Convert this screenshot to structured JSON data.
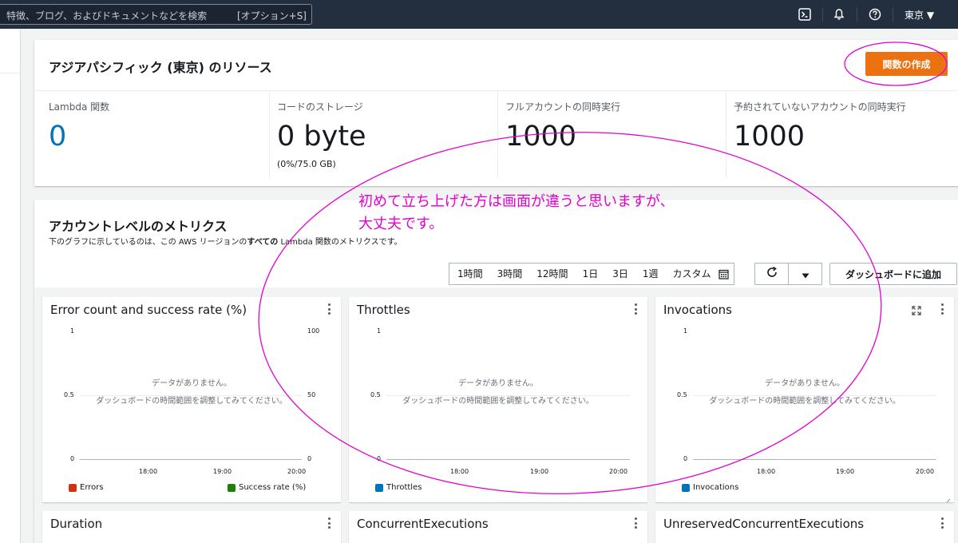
{
  "search": {
    "placeholder": "特徴、ブログ、およびドキュメントなどを検索",
    "shortcut": "[オプション+S]"
  },
  "nav": {
    "region": "東京 ▼"
  },
  "resources": {
    "title": "アジアパシフィック (東京) のリソース",
    "create_button": "関数の作成",
    "stats": [
      {
        "label": "Lambda 関数",
        "value": "0"
      },
      {
        "label": "コードのストレージ",
        "value": "0 byte",
        "sub": "(0%/75.0 GB)"
      },
      {
        "label": "フルアカウントの同時実行",
        "value": "1000"
      },
      {
        "label": "予約されていないアカウントの同時実行",
        "value": "1000"
      }
    ]
  },
  "metrics": {
    "title": "アカウントレベルのメトリクス",
    "desc_pre": "下のグラフに示しているのは、この AWS リージョンの",
    "desc_bold": "すべての",
    "desc_post": " Lambda 関数のメトリクスです。",
    "ranges": [
      "1時間",
      "3時間",
      "12時間",
      "1日",
      "3日",
      "1週",
      "カスタム"
    ],
    "add_dashboard": "ダッシュボードに追加"
  },
  "charts": [
    {
      "title": "Error count and success rate (%)",
      "y_left": [
        "1",
        "0.5",
        "0"
      ],
      "y_right": [
        "100",
        "50",
        "0"
      ],
      "x": [
        "18:00",
        "19:00",
        "20:00"
      ],
      "nodata_1": "データがありません。",
      "nodata_2": "ダッシュボードの時間範囲を調整してみてください。",
      "legend": [
        {
          "name": "Errors",
          "color": "#d13212"
        },
        {
          "name": "Success rate (%)",
          "color": "#1d8102"
        }
      ]
    },
    {
      "title": "Throttles",
      "y_left": [
        "1",
        "0.5",
        "0"
      ],
      "x": [
        "18:00",
        "19:00",
        "20:00"
      ],
      "nodata_1": "データがありません。",
      "nodata_2": "ダッシュボードの時間範囲を調整してみてください。",
      "legend": [
        {
          "name": "Throttles",
          "color": "#0073bb"
        }
      ]
    },
    {
      "title": "Invocations",
      "y_left": [
        "1",
        "0.5",
        "0"
      ],
      "x": [
        "18:00",
        "19:00",
        "20:00"
      ],
      "nodata_1": "データがありません。",
      "nodata_2": "ダッシュボードの時間範囲を調整してみてください。",
      "legend": [
        {
          "name": "Invocations",
          "color": "#0073bb"
        }
      ]
    }
  ],
  "bottom_cards": [
    {
      "title": "Duration"
    },
    {
      "title": "ConcurrentExecutions"
    },
    {
      "title": "UnreservedConcurrentExecutions"
    }
  ],
  "annotation": {
    "line1": "初めて立ち上げた方は画面が違うと思いますが、",
    "line2": "大丈夫です。",
    "color": "#e400d0"
  }
}
